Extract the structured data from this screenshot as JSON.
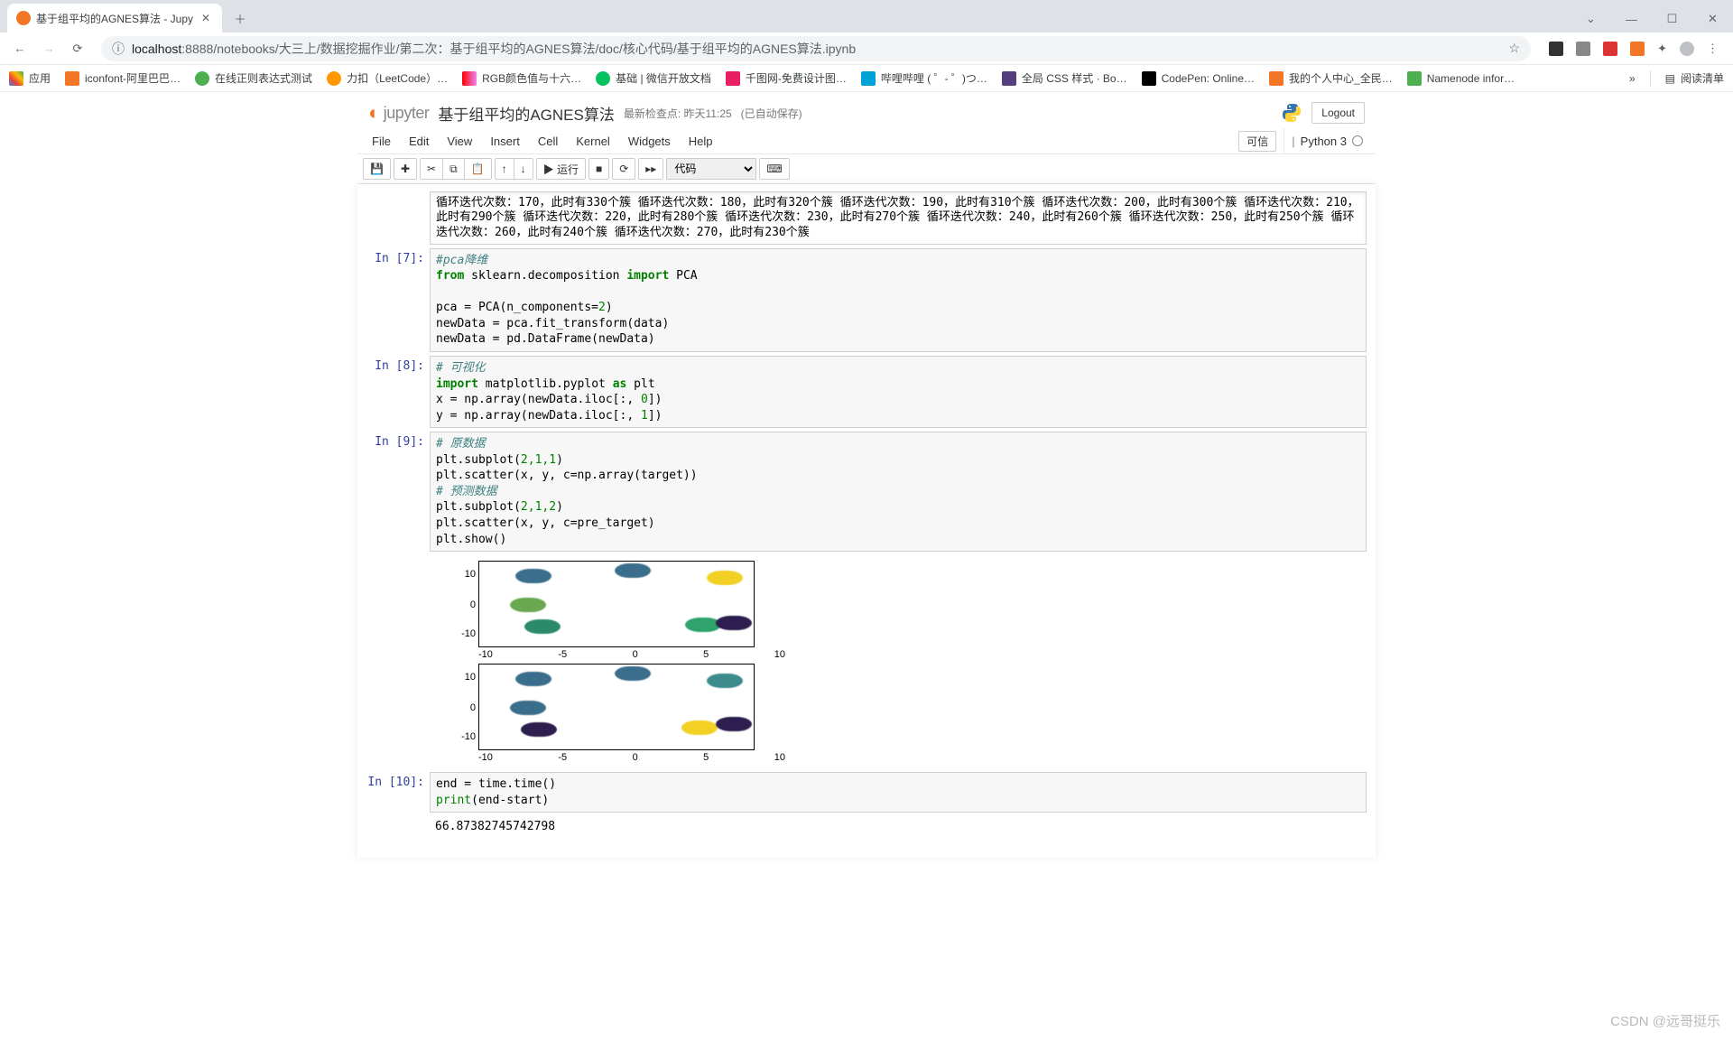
{
  "browser": {
    "tab_title": "基于组平均的AGNES算法 - Jupy",
    "url_host": "localhost",
    "url_port": ":8888",
    "url_path": "/notebooks/大三上/数据挖掘作业/第二次：基于组平均的AGNES算法/doc/核心代码/基于组平均的AGNES算法.ipynb"
  },
  "bookmarks": {
    "apps": "应用",
    "items": [
      "iconfont-阿里巴巴…",
      "在线正则表达式测试",
      "力扣（LeetCode）…",
      "RGB颜色值与十六…",
      "基础 | 微信开放文档",
      "千图网-免费设计图…",
      "哔哩哔哩 ( ゜- ゜)つ…",
      "全局 CSS 样式 · Bo…",
      "CodePen: Online…",
      "我的个人中心_全民…",
      "Namenode infor…"
    ],
    "overflow": "»",
    "reading_list": "阅读清单"
  },
  "jupyter": {
    "logo_text": "jupyter",
    "title": "基于组平均的AGNES算法",
    "checkpoint": "最新检查点: 昨天11:25",
    "autosave": "(已自动保存)",
    "logout": "Logout",
    "trusted": "可信",
    "kernel_name": "Python 3",
    "menus": [
      "File",
      "Edit",
      "View",
      "Insert",
      "Cell",
      "Kernel",
      "Widgets",
      "Help"
    ],
    "run_label": "▶ 运行",
    "cell_type_selected": "代码"
  },
  "cells": {
    "output_iter": "循环迭代次数：170，此时有330个簇\n循环迭代次数：180，此时有320个簇\n循环迭代次数：190，此时有310个簇\n循环迭代次数：200，此时有300个簇\n循环迭代次数：210，此时有290个簇\n循环迭代次数：220，此时有280个簇\n循环迭代次数：230，此时有270个簇\n循环迭代次数：240，此时有260个簇\n循环迭代次数：250，此时有250个簇\n循环迭代次数：260，此时有240个簇\n循环迭代次数：270，此时有230个簇",
    "in7_prompt": "In  [7]:",
    "in7_l1_comment": "#pca降维",
    "in7_l2_from": "from",
    "in7_l2_mod": " sklearn.decomposition ",
    "in7_l2_import": "import",
    "in7_l2_name": " PCA",
    "in7_l4": "pca = PCA(n_components=",
    "in7_l4_num": "2",
    "in7_l4_end": ")",
    "in7_l5": "newData = pca.fit_transform(data)",
    "in7_l6": "newData = pd.DataFrame(newData)",
    "in8_prompt": "In  [8]:",
    "in8_l1_comment": "# 可视化",
    "in8_l2_import": "import",
    "in8_l2_mod": " matplotlib.pyplot ",
    "in8_l2_as": "as",
    "in8_l2_alias": " plt",
    "in8_l3a": "x = np.array(newData.iloc[:, ",
    "in8_l3n": "0",
    "in8_l3b": "])",
    "in8_l4a": "y = np.array(newData.iloc[:, ",
    "in8_l4n": "1",
    "in8_l4b": "])",
    "in9_prompt": "In  [9]:",
    "in9_l1_comment": "# 原数据",
    "in9_l2a": "plt.subplot(",
    "in9_l2n": "2,1,1",
    "in9_l2b": ")",
    "in9_l3": "plt.scatter(x, y, c=np.array(target))",
    "in9_l4_comment": "# 预测数据",
    "in9_l5a": "plt.subplot(",
    "in9_l5n": "2,1,2",
    "in9_l5b": ")",
    "in9_l6": "plt.scatter(x, y, c=pre_target)",
    "in9_l7": "plt.show()",
    "in10_prompt": "In [10]:",
    "in10_l1": "end = time.time()",
    "in10_l2a": "print",
    "in10_l2b": "(end-start)",
    "in10_output": "66.87382745742798"
  },
  "chart_data": [
    {
      "type": "scatter",
      "title": "",
      "xlabel": "",
      "ylabel": "",
      "xlim": [
        -15,
        15
      ],
      "ylim": [
        -15,
        15
      ],
      "x_ticks": [
        -10,
        -5,
        0,
        5,
        10
      ],
      "y_ticks": [
        -10,
        0,
        10
      ],
      "clusters": [
        {
          "cx": -9,
          "cy": 9,
          "color": "#3b6e8c"
        },
        {
          "cx": 0,
          "cy": 12,
          "color": "#3b6e8c"
        },
        {
          "cx": 10,
          "cy": 8,
          "color": "#f2d024"
        },
        {
          "cx": -10,
          "cy": -1,
          "color": "#6aa84f"
        },
        {
          "cx": -8,
          "cy": -9,
          "color": "#2a8a6a"
        },
        {
          "cx": 7,
          "cy": -8,
          "color": "#2fa36b"
        },
        {
          "cx": 11,
          "cy": -8,
          "color": "#2d1e4f"
        }
      ]
    },
    {
      "type": "scatter",
      "title": "",
      "xlabel": "",
      "ylabel": "",
      "xlim": [
        -15,
        15
      ],
      "ylim": [
        -15,
        15
      ],
      "x_ticks": [
        -10,
        -5,
        0,
        5,
        10
      ],
      "y_ticks": [
        -10,
        0,
        10
      ],
      "clusters": [
        {
          "cx": -9,
          "cy": 9,
          "color": "#3b6e8c"
        },
        {
          "cx": 0,
          "cy": 12,
          "color": "#3b6e8c"
        },
        {
          "cx": 10,
          "cy": 8,
          "color": "#3b8a8c"
        },
        {
          "cx": -10,
          "cy": -1,
          "color": "#3b6e8c"
        },
        {
          "cx": -9,
          "cy": -9,
          "color": "#2d1e4f"
        },
        {
          "cx": 6,
          "cy": -8,
          "color": "#f2d024"
        },
        {
          "cx": 11,
          "cy": -8,
          "color": "#2d1e4f"
        }
      ]
    }
  ],
  "axis": {
    "y10": "10",
    "y0": "0",
    "ym10": "-10",
    "xm10": "-10",
    "xm5": "-5",
    "x0": "0",
    "x5": "5",
    "x10": "10"
  },
  "watermark": "CSDN @远哥挺乐"
}
